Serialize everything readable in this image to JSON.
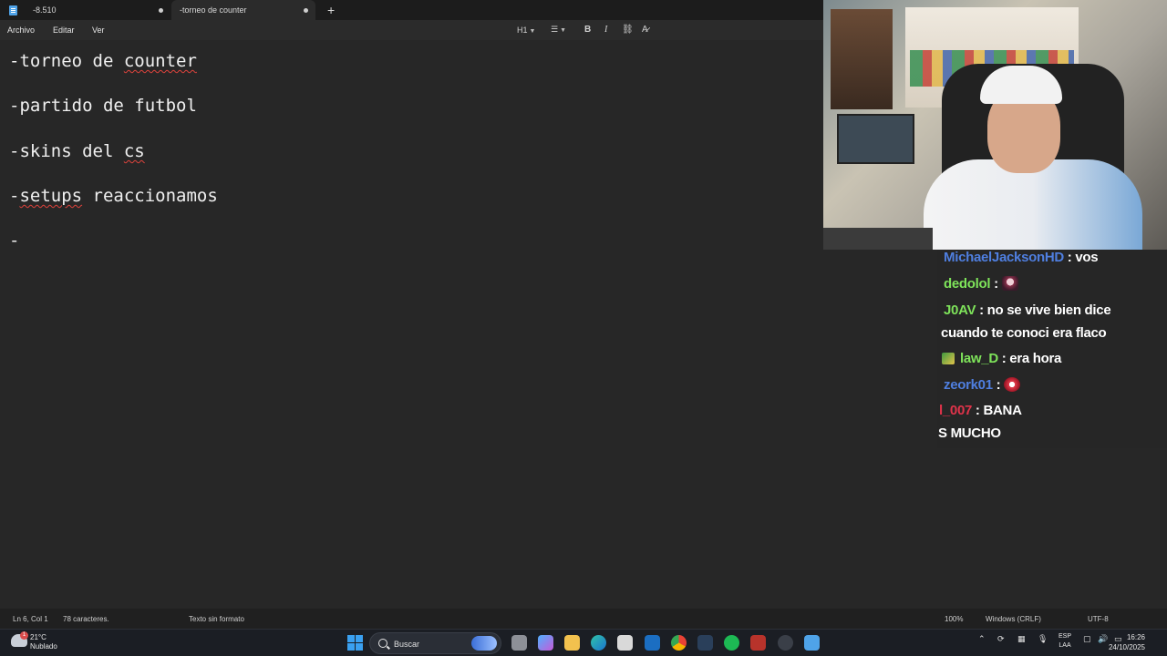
{
  "tabs": [
    {
      "label": "-8.510",
      "unsaved": true
    },
    {
      "label": "-torneo de counter",
      "unsaved": true,
      "active": true
    }
  ],
  "new_tab": "+",
  "menu": {
    "file": "Archivo",
    "edit": "Editar",
    "view": "Ver"
  },
  "toolbar": {
    "heading": "H1",
    "list": "☰",
    "bold": "B",
    "italic": "I",
    "link": "⛓",
    "clear_format": "A̷"
  },
  "document": {
    "lines": [
      "-torneo de counter",
      "-partido de futbol",
      "-skins del cs",
      "-setups reaccionamos",
      "-"
    ]
  },
  "chat": {
    "messages": [
      {
        "user": "MichaelJacksonHD",
        "user_color": "#4f7fe0",
        "text": " : vos"
      },
      {
        "user": "dedolol",
        "user_color": "#7ee35a",
        "text": " : ",
        "emote": "skull-emote"
      },
      {
        "user": "J0AV",
        "user_color": "#7ee35a",
        "text": " : no se vive bien dice"
      },
      {
        "user": "",
        "text": "cuando te conoci era flaco"
      },
      {
        "user": "law_D",
        "user_color": "#7ee35a",
        "text": " : era hora",
        "badge": true
      },
      {
        "user": "zeork01",
        "user_color": "#4f7fe0",
        "text": " : ",
        "emote": "heart-emote"
      },
      {
        "user": "l_007",
        "user_color": "#e0334a",
        "text": " : BANA"
      },
      {
        "user": "",
        "text": "S MUCHO"
      }
    ]
  },
  "status": {
    "position": "Ln 6, Col 1",
    "chars": "78 caracteres.",
    "format": "Texto sin formato",
    "zoom": "100%",
    "line_ending": "Windows (CRLF)",
    "encoding": "UTF-8"
  },
  "taskbar": {
    "temperature": "21°C",
    "weather": "Nublado",
    "weather_badge": "1",
    "search_placeholder": "Buscar",
    "lang_top": "ESP",
    "lang_bottom": "LAA",
    "time": "16:26",
    "date": "24/10/2025"
  },
  "colors": {
    "editor_bg": "#272727",
    "spellcheck": "#e0433c",
    "accent": "#3aa0f0"
  }
}
